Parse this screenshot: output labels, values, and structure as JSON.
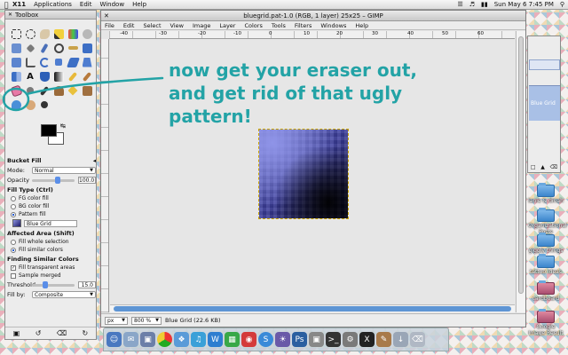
{
  "menubar": {
    "apple": "",
    "app": "X11",
    "items": [
      "Applications",
      "Edit",
      "Window",
      "Help"
    ],
    "clock": "Sun May 6  7:45 PM"
  },
  "toolbox": {
    "title": "Toolbox",
    "tool_options": {
      "title": "Bucket Fill",
      "mode_label": "Mode:",
      "mode_value": "Normal",
      "opacity_label": "Opacity",
      "opacity_value": "100.0",
      "fill_type_label": "Fill Type  (Ctrl)",
      "fill_types": [
        "FG color fill",
        "BG color fill",
        "Pattern fill"
      ],
      "pattern_name": "Blue Grid",
      "affected_area_label": "Affected Area  (Shift)",
      "affected_areas": [
        "Fill whole selection",
        "Fill similar colors"
      ],
      "similar_colors_label": "Finding Similar Colors",
      "fill_transparent": "Fill transparent areas",
      "sample_merged": "Sample merged",
      "threshold_label": "Threshold",
      "threshold_value": "15.0",
      "fill_by_label": "Fill by:",
      "fill_by_value": "Composite"
    }
  },
  "image_window": {
    "title": "bluegrid.pat-1.0 (RGB, 1 layer) 25x25 – GIMP",
    "menu": [
      "File",
      "Edit",
      "Select",
      "View",
      "Image",
      "Layer",
      "Colors",
      "Tools",
      "Filters",
      "Windows",
      "Help"
    ],
    "ruler_marks": [
      "-40",
      "-30",
      "-20",
      "-10",
      "0",
      "10",
      "20",
      "30",
      "40",
      "50",
      "60"
    ],
    "unit": "px",
    "zoom": "800 %",
    "status": "Blue Grid (22.6 KB)"
  },
  "layers_dock": {
    "layer_name": "Blue Grid"
  },
  "desktop_icons": [
    {
      "label": "lanie & dinah"
    },
    {
      "label": "Organizational Posts"
    },
    {
      "label": "giggly things"
    },
    {
      "label": "tattoo ideas"
    },
    {
      "label": "cardboard"
    },
    {
      "label": "Google Image Result"
    }
  ],
  "annotation": {
    "line1": "now get your eraser out,",
    "line2": "and get rid of that ugly",
    "line3": "pattern!"
  },
  "colors": {
    "annotation": "#23a3a6",
    "selection": "#5e95d4"
  }
}
